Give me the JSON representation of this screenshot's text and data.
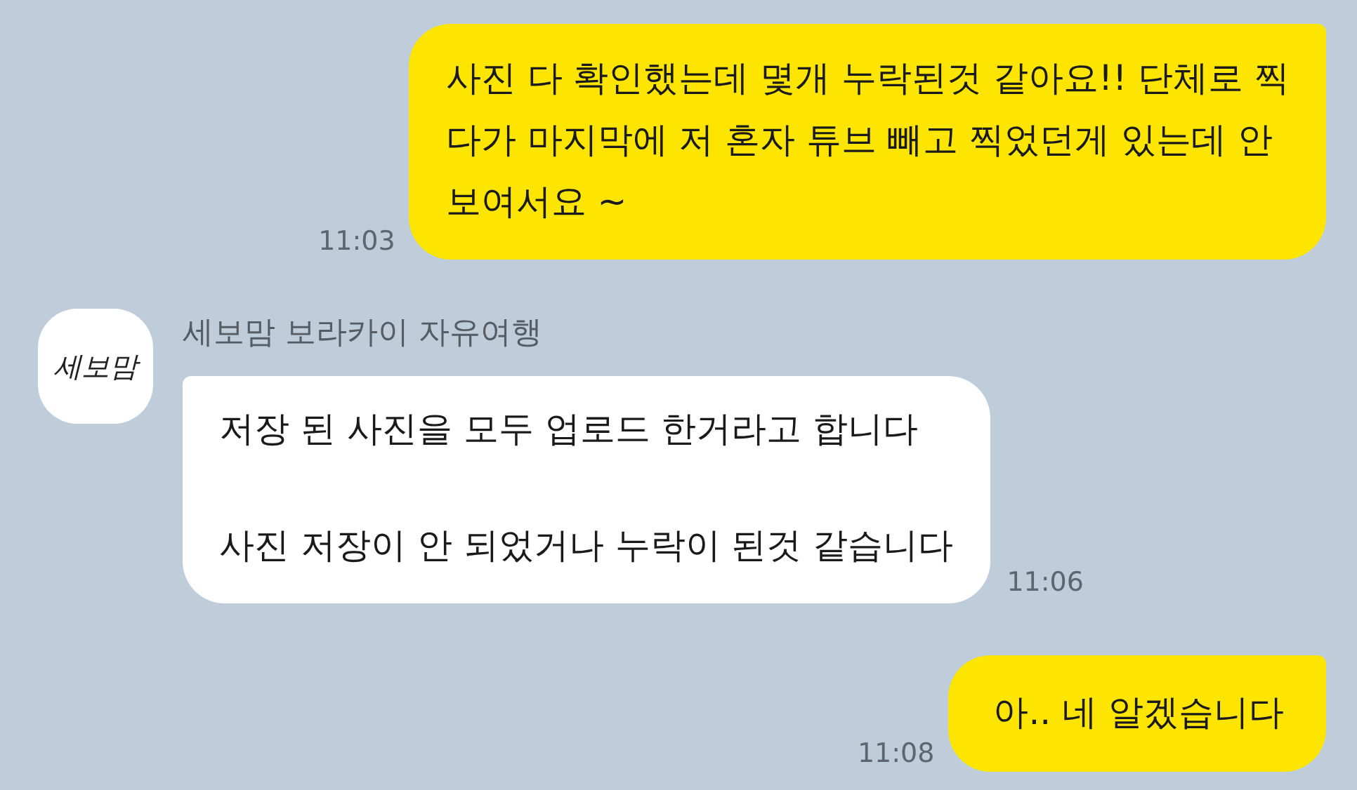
{
  "messages": [
    {
      "kind": "sent",
      "paragraphs": [
        [
          "사진 다 확인했는데 몇개 누락된것 같아요!! 단체로 찍",
          "다가 마지막에 저 혼자 튜브 빼고 찍었던게 있는데 안",
          "보여서요 ~"
        ]
      ],
      "time": "11:03"
    },
    {
      "kind": "received",
      "sender": "세보맘 보라카이 자유여행",
      "avatar": {
        "logo_text": "세보맘"
      },
      "paragraphs": [
        [
          "저장 된 사진을 모두 업로드 한거라고 합니다"
        ],
        [
          "사진 저장이 안 되었거나 누락이 된것 같습니다"
        ]
      ],
      "time": "11:06"
    },
    {
      "kind": "sent",
      "paragraphs": [
        [
          "아.. 네 알겠습니다"
        ]
      ],
      "time": "11:08"
    }
  ]
}
